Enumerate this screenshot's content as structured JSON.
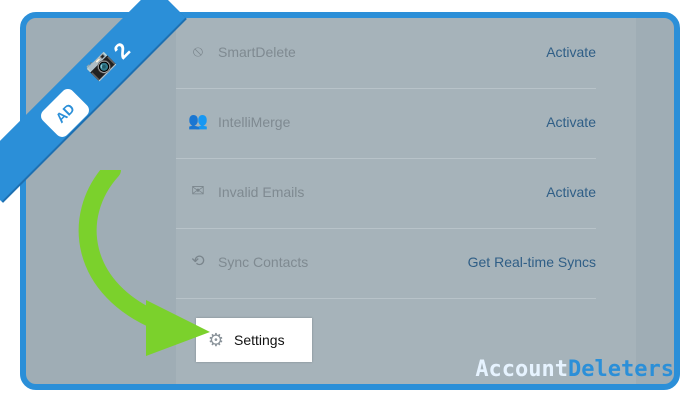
{
  "step": {
    "number": "2"
  },
  "rows": [
    {
      "label": "SmartDelete",
      "action": "Activate",
      "icon": "smartdelete-icon"
    },
    {
      "label": "IntelliMerge",
      "action": "Activate",
      "icon": "intellimerge-icon"
    },
    {
      "label": "Invalid Emails",
      "action": "Activate",
      "icon": "invalid-emails-icon"
    },
    {
      "label": "Sync Contacts",
      "action": "Get Real-time Syncs",
      "icon": "sync-icon"
    }
  ],
  "settings": {
    "label": "Settings",
    "icon": "gear-icon"
  },
  "watermark": {
    "part1": "Account",
    "part2": "Deleters"
  },
  "colors": {
    "frame": "#2b8fd8",
    "arrow": "#7bd12c"
  }
}
